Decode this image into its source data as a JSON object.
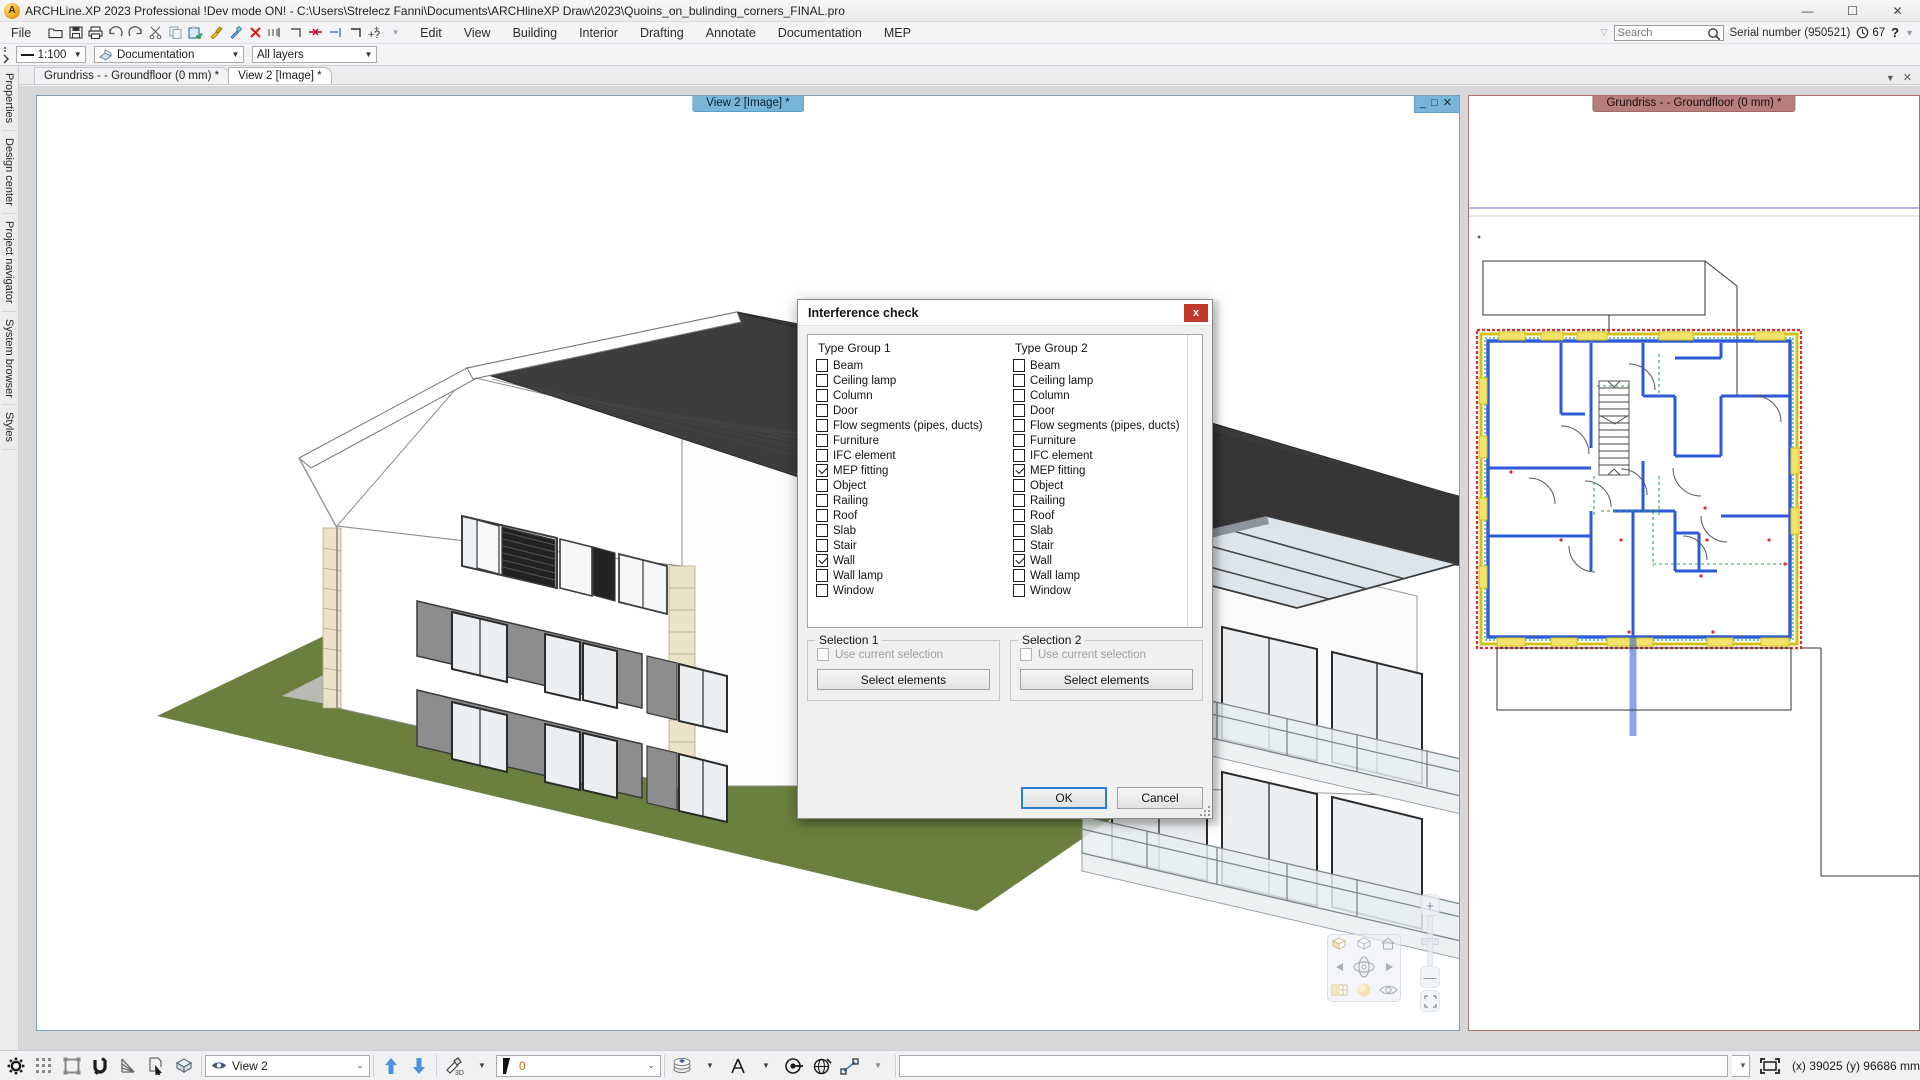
{
  "window": {
    "app_icon": "archline-logo-icon",
    "title": "ARCHLine.XP 2023 Professional !Dev mode ON! - C:\\Users\\Strelecz Fanni\\Documents\\ARCHlineXP Draw\\2023\\Quoins_on_bulinding_corners_FINAL.pro",
    "minimize": "—",
    "maximize": "☐",
    "close": "✕"
  },
  "menubar": {
    "items": [
      "File",
      "Edit",
      "View",
      "Building",
      "Interior",
      "Drafting",
      "Annotate",
      "Documentation",
      "MEP"
    ],
    "quick_access": [
      "open-folder-icon",
      "save-icon",
      "print-icon",
      "undo-icon",
      "redo-icon",
      "cut-icon",
      "copy-icon",
      "paste-icon",
      "paint-brush-icon",
      "eyedropper-icon",
      "delete-icon",
      "dimension-icon",
      "corner-icon",
      "trim-icon",
      "extend-icon",
      "chamfer-icon",
      "add-help-icon",
      "more-chevron-icon"
    ],
    "search": {
      "placeholder": "Search",
      "value": "",
      "icon": "search-icon"
    },
    "serial_number": "Serial number (950521)",
    "clock_icon": "clock-icon",
    "clock_value": "67",
    "help": "?",
    "help_chevron": "▼",
    "overflow_chevron": "▽"
  },
  "optionsbar": {
    "grip_icon": "drag-grip-icon",
    "scale": {
      "label": "1:100",
      "icon": "line-scale-icon",
      "arrow": "▼"
    },
    "document": {
      "label": "Documentation",
      "icon": "documentation-icon",
      "arrow": "▼"
    },
    "layers": {
      "label": "All layers",
      "arrow": "▼"
    }
  },
  "left_rail": {
    "tabs": [
      "Properties",
      "Design center",
      "Project navigator",
      "System browser",
      "Styles"
    ]
  },
  "doc_tabs": {
    "tabs": [
      {
        "label": "Grundriss -  - Groundfloor (0 mm) *",
        "active": false
      },
      {
        "label": "View 2 [Image] *",
        "active": true
      }
    ],
    "right_chevron": "▼",
    "right_close": "✕"
  },
  "panes": {
    "view3d": {
      "caption": "View 2 [Image] *",
      "minimize": "_",
      "maximize": "□",
      "close": "✕",
      "nav_icons": [
        "box-yellow-face-icon",
        "box-white-icon",
        "house-icon",
        "rotate-left-icon",
        "orbit-icon",
        "rotate-right-icon",
        "render-modes-icon",
        "sun-light-icon",
        "eye-view-icon"
      ],
      "zoom_in": "+",
      "zoom_out": "—",
      "fit_icon": "fit-to-window-icon"
    },
    "floorplan": {
      "caption": "Grundriss -  - Groundfloor (0 mm) *"
    }
  },
  "dialog": {
    "title": "Interference check",
    "close_label": "x",
    "type_group_1": {
      "title": "Type Group 1",
      "items": [
        {
          "label": "Beam",
          "checked": false
        },
        {
          "label": "Ceiling lamp",
          "checked": false
        },
        {
          "label": "Column",
          "checked": false
        },
        {
          "label": "Door",
          "checked": false
        },
        {
          "label": "Flow segments (pipes, ducts)",
          "checked": false
        },
        {
          "label": "Furniture",
          "checked": false
        },
        {
          "label": "IFC element",
          "checked": false
        },
        {
          "label": "MEP fitting",
          "checked": true
        },
        {
          "label": "Object",
          "checked": false
        },
        {
          "label": "Railing",
          "checked": false
        },
        {
          "label": "Roof",
          "checked": false
        },
        {
          "label": "Slab",
          "checked": false
        },
        {
          "label": "Stair",
          "checked": false
        },
        {
          "label": "Wall",
          "checked": true
        },
        {
          "label": "Wall lamp",
          "checked": false
        },
        {
          "label": "Window",
          "checked": false
        }
      ]
    },
    "type_group_2": {
      "title": "Type Group 2",
      "items": [
        {
          "label": "Beam",
          "checked": false
        },
        {
          "label": "Ceiling lamp",
          "checked": false
        },
        {
          "label": "Column",
          "checked": false
        },
        {
          "label": "Door",
          "checked": false
        },
        {
          "label": "Flow segments (pipes, ducts)",
          "checked": false
        },
        {
          "label": "Furniture",
          "checked": false
        },
        {
          "label": "IFC element",
          "checked": false
        },
        {
          "label": "MEP fitting",
          "checked": true
        },
        {
          "label": "Object",
          "checked": false
        },
        {
          "label": "Railing",
          "checked": false
        },
        {
          "label": "Roof",
          "checked": false
        },
        {
          "label": "Slab",
          "checked": false
        },
        {
          "label": "Stair",
          "checked": false
        },
        {
          "label": "Wall",
          "checked": true
        },
        {
          "label": "Wall lamp",
          "checked": false
        },
        {
          "label": "Window",
          "checked": false
        }
      ]
    },
    "selection_1": {
      "title": "Selection 1",
      "use_current_selection": "Use current selection",
      "use_current_checked": false,
      "select_elements": "Select elements"
    },
    "selection_2": {
      "title": "Selection 2",
      "use_current_selection": "Use current selection",
      "use_current_checked": false,
      "select_elements": "Select elements"
    },
    "ok": "OK",
    "cancel": "Cancel"
  },
  "statusbar": {
    "tools": [
      "settings-gear-icon",
      "grid-icon",
      "ortho-icon",
      "snap-magnet-icon",
      "angle-snap-icon",
      "select-cursor-icon",
      "3d-box-icon"
    ],
    "view_combo": {
      "label": "View 2",
      "icon": "eye-icon",
      "arrow": "⌄"
    },
    "up_icon": "arrow-up-icon",
    "down_icon": "arrow-down-icon",
    "hammer_icon": "hammer-3d-icon",
    "hammer_arrow": "▼",
    "pen_combo": {
      "value": "0",
      "icon": "pen-thickness-icon",
      "arrow": "⌄"
    },
    "layer_icon": "layers-icon",
    "layer_arrow": "▼",
    "text_icon": "text-style-icon",
    "text_arrow": "▼",
    "target_icon": "target-snap-icon",
    "globe_icon": "globe-icon",
    "dimension_icon": "dimension-node-icon",
    "dimension_arrow": "▼",
    "command_input": "",
    "zoom_fit_icon": "zoom-fit-icon",
    "coordinates": "(x) 39025   (y) 96686 mm"
  },
  "colors": {
    "accent_blue": "#79b4d9",
    "accent_red": "#b77e7c",
    "close_red": "#c0392b",
    "ok_border": "#2a7fd4",
    "roof": "#3b3b3b",
    "ground": "#6b7f3e",
    "quoin": "#ede3c8",
    "plan_wall": "#2d5bd7"
  }
}
